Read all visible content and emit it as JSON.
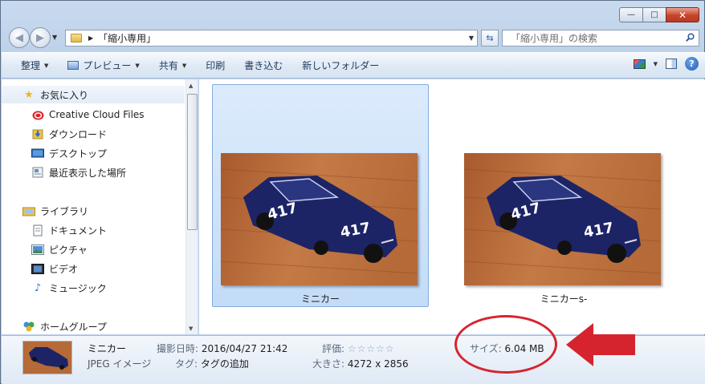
{
  "window": {
    "minimize_glyph": "—",
    "maximize_glyph": "□",
    "close_glyph": "✕"
  },
  "address": {
    "path": "「縮小専用」",
    "search_placeholder": "「縮小専用」の検索"
  },
  "toolbar": {
    "organize": "整理",
    "preview": "プレビュー",
    "share": "共有",
    "print": "印刷",
    "burn": "書き込む",
    "new_folder": "新しいフォルダー"
  },
  "nav": {
    "favorites_header": "お気に入り",
    "favorites": [
      "Creative Cloud Files",
      "ダウンロード",
      "デスクトップ",
      "最近表示した場所"
    ],
    "libraries_header": "ライブラリ",
    "libraries": [
      "ドキュメント",
      "ピクチャ",
      "ビデオ",
      "ミュージック"
    ],
    "homegroup_header": "ホームグループ"
  },
  "files": [
    {
      "name": "ミニカー",
      "selected": true
    },
    {
      "name": "ミニカーs-",
      "selected": false
    }
  ],
  "details": {
    "name": "ミニカー",
    "type": "JPEG イメージ",
    "date_label": "撮影日時:",
    "date_value": "2016/04/27 21:42",
    "tags_label": "タグ:",
    "tags_value": "タグの追加",
    "rating_label": "評価:",
    "rating_stars": "☆☆☆☆☆",
    "dimensions_label": "大きさ:",
    "dimensions_value": "4272 x 2856",
    "size_label": "サイズ:",
    "size_value": "6.04 MB"
  },
  "annotation": {
    "color": "#d6242f"
  }
}
